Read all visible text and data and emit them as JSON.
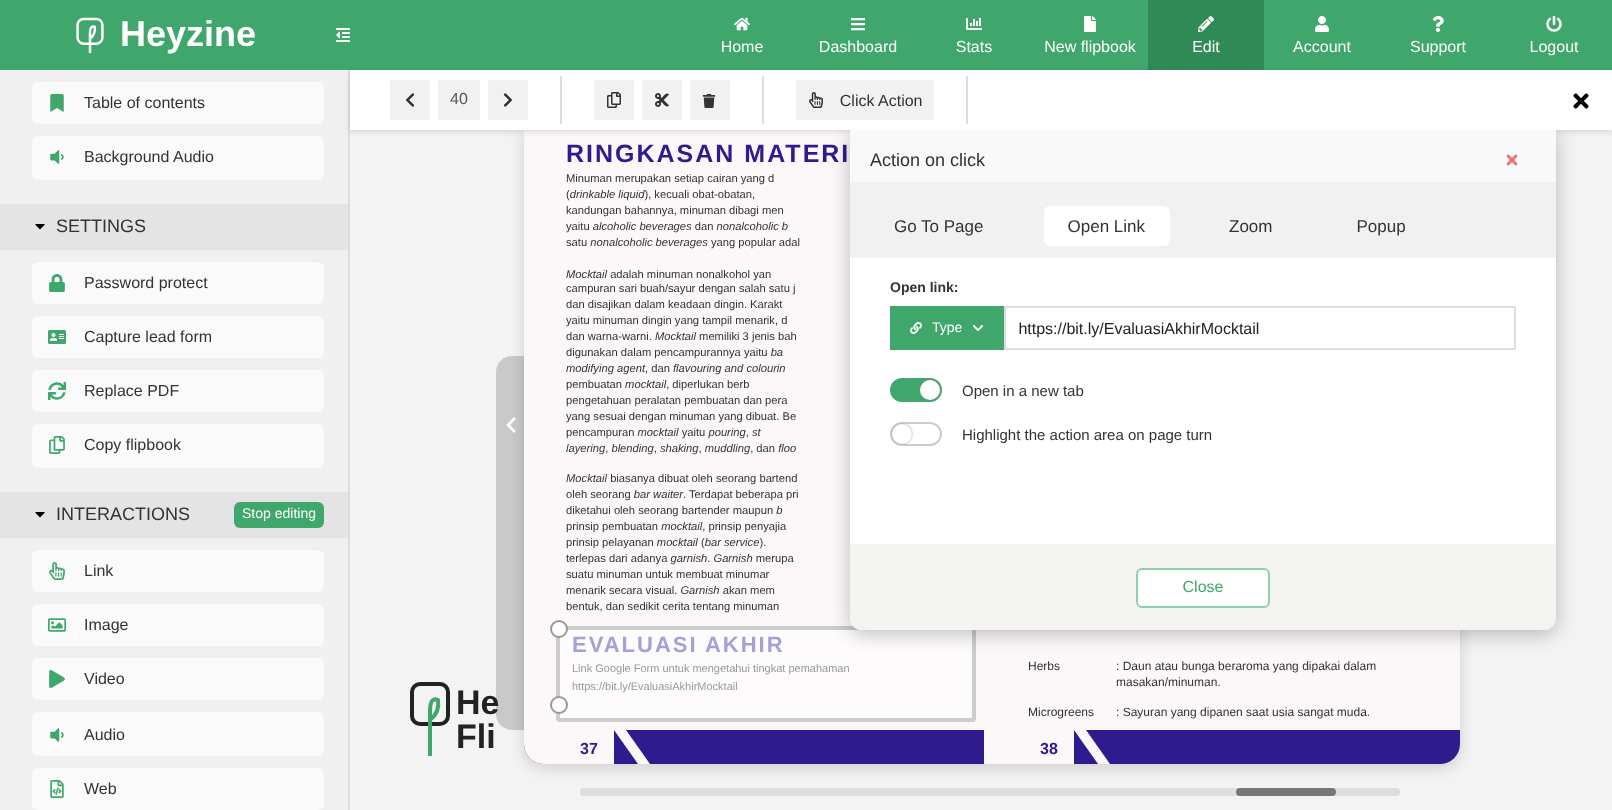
{
  "header": {
    "brand": "Heyzine",
    "nav": [
      {
        "label": "Home",
        "selected": false
      },
      {
        "label": "Dashboard",
        "selected": false
      },
      {
        "label": "Stats",
        "selected": false
      },
      {
        "label": "New flipbook",
        "selected": false
      },
      {
        "label": "Edit",
        "selected": true
      },
      {
        "label": "Account",
        "selected": false
      },
      {
        "label": "Support",
        "selected": false
      },
      {
        "label": "Logout",
        "selected": false
      }
    ]
  },
  "sidebar": {
    "items": [
      "Table of contents",
      "Background Audio"
    ],
    "sections": [
      {
        "title": "SETTINGS",
        "expanded": true,
        "items": [
          "Password protect",
          "Capture lead form",
          "Replace PDF",
          "Copy flipbook"
        ]
      },
      {
        "title": "INTERACTIONS",
        "expanded": true,
        "button": "Stop editing",
        "items": [
          "Link",
          "Image",
          "Video",
          "Audio",
          "Web"
        ]
      }
    ]
  },
  "toolbar": {
    "page": "40",
    "action": "Click Action"
  },
  "canvas": {
    "brand_lines": [
      "He",
      "Fli"
    ],
    "left_page": {
      "title": "RINGKASAN MATERI",
      "paragraphs": [
        [
          "Minuman merupakan setiap cairan yang d",
          "(*drinkable liquid*), kecuali obat-obatan,",
          "kandungan bahannya, minuman dibagi men",
          "yaitu *alcoholic beverages* dan *nonalcoholic b*",
          "satu *nonalcoholic beverages* yang popular adal"
        ],
        [
          "*Mocktail* adalah minuman nonalkohol yan",
          "campuran sari buah/sayur dengan salah satu j",
          "dan disajikan dalam keadaan dingin. Karakt",
          "yaitu minuman dingin yang tampil menarik, d",
          "dan warna-warni. *Mocktail* memiliki 3 jenis bah",
          "digunakan dalam pencampurannya yaitu *ba*",
          "*modifying agent*, dan *flavouring and colourin*",
          "pembuatan *mocktail*, diperlukan berb",
          "pengetahuan peralatan pembuatan dan pera",
          "yang sesuai dengan minuman yang dibuat. Be",
          "pencampuran *mocktail* yaitu *pouring*, *st*",
          "*layering*, *blending*, *shaking*, *muddling*, dan *floo*"
        ],
        [
          "*Mocktail* biasanya dibuat oleh seorang bartend",
          "oleh seorang *bar waiter*. Terdapat beberapa pri",
          "diketahui oleh seorang bartender maupun *b*",
          "prinsip pembuatan *mocktail*, prinsip penyajia",
          "prinsip pelayanan *mocktail* (*bar service*).",
          "terlepas dari adanya *garnish*. *Garnish* merupa",
          "suatu minuman untuk membuat minumar",
          "menarik secara visual. *Garnish* akan mem",
          "bentuk, dan sedikit cerita tentang minuman"
        ]
      ],
      "link_box": {
        "title": "EVALUASI AKHIR",
        "text": "Link Google Form untuk mengetahui tingkat pemahaman",
        "url": "https://bit.ly/EvaluasiAkhirMocktail"
      },
      "page_number": "37"
    },
    "right_page": {
      "glossary": [
        {
          "term": "Herbs",
          "definition": ": Daun atau bunga beraroma yang dipakai dalam masakan/minuman."
        },
        {
          "term": "Microgreens",
          "definition": ": Sayuran yang dipanen saat usia sangat muda."
        }
      ],
      "page_number": "38"
    }
  },
  "modal": {
    "title": "Action on click",
    "tabs": [
      {
        "label": "Go To Page",
        "selected": false
      },
      {
        "label": "Open Link",
        "selected": true
      },
      {
        "label": "Zoom",
        "selected": false
      },
      {
        "label": "Popup",
        "selected": false
      }
    ],
    "field_label": "Open link:",
    "type_button": "Type",
    "value": "https://bit.ly/EvaluasiAkhirMocktail",
    "toggles": [
      {
        "label": "Open in a new tab",
        "on": true
      },
      {
        "label": "Highlight the action area on page turn",
        "on": false
      }
    ],
    "close_button": "Close"
  }
}
